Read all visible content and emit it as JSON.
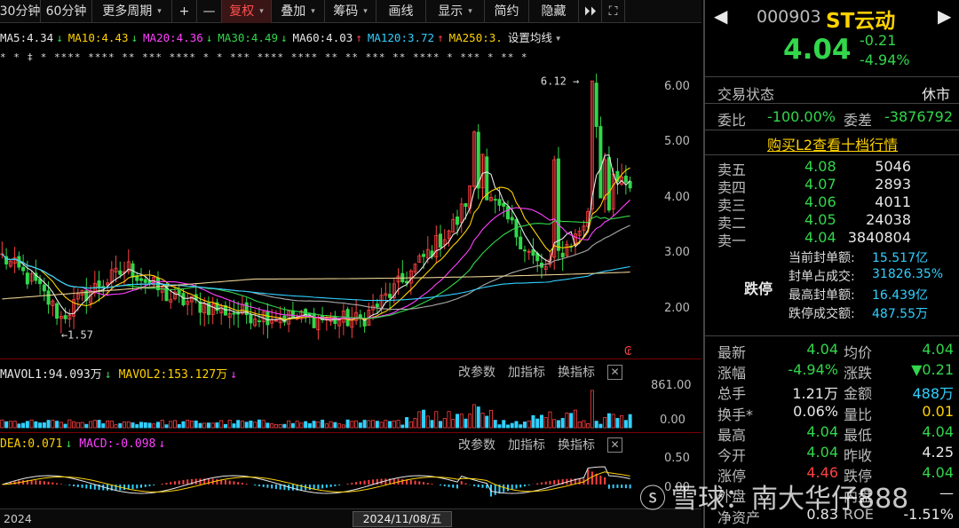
{
  "toolbar": {
    "items": [
      "30分钟",
      "60分钟",
      "更多周期",
      "+",
      "—",
      "复权",
      "叠加",
      "筹码",
      "画线",
      "显示",
      "简约",
      "隐藏",
      "⏵⏵",
      "⛶"
    ],
    "dropdown_caret": "▾",
    "active_item": "复权"
  },
  "ma_legend": [
    {
      "label": "MA5:4.34",
      "arrow": "↓",
      "color": "#e8e8e8",
      "arrow_color": "#32d74b"
    },
    {
      "label": "MA10:4.43",
      "arrow": "↓",
      "color": "#ffd200",
      "arrow_color": "#32d74b"
    },
    {
      "label": "MA20:4.36",
      "arrow": "↓",
      "color": "#ff40ff",
      "arrow_color": "#32d74b"
    },
    {
      "label": "MA30:4.49",
      "arrow": "↓",
      "color": "#32d74b",
      "arrow_color": "#32d74b"
    },
    {
      "label": "MA60:4.03",
      "arrow": "↑",
      "color": "#e8e8e8",
      "arrow_color": "#ff4040"
    },
    {
      "label": "MA120:3.72",
      "arrow": "↑",
      "color": "#30d0ff",
      "arrow_color": "#ff4040"
    },
    {
      "label": "MA250:3.",
      "arrow": "",
      "color": "#ffd200",
      "arrow_color": "#ffd200"
    },
    {
      "label": "设置均线",
      "arrow": "▾",
      "color": "#e8e8e8",
      "arrow_color": "#aaa"
    }
  ],
  "event_marks": "* * ‡      *    ****  ****  ** ***  ****  * *  ***  ****  ****  ** **  ***   ** ****  *  ***  * **  *",
  "price_axis": {
    "labels": [
      "6.00",
      "5.00",
      "4.00",
      "3.00",
      "2.00"
    ],
    "values": [
      6,
      5,
      4,
      3,
      2
    ],
    "max_marker": "6.12",
    "min_marker": "1.57",
    "icon": "₢"
  },
  "volume_panel": {
    "legend": [
      {
        "label": "MAVOL1:94.093万",
        "arrow": "↓",
        "color": "#e8e8e8",
        "arrow_color": "#32d74b"
      },
      {
        "label": "MAVOL2:153.127万",
        "arrow": "↓",
        "color": "#ffd200",
        "arrow_color": "#ff40ff"
      }
    ],
    "buttons": [
      "改参数",
      "加指标",
      "换指标"
    ],
    "close": "✕",
    "axis_labels": [
      "861.00",
      "0.00"
    ]
  },
  "macd_panel": {
    "legend": [
      {
        "label": "DEA:0.071",
        "arrow": "↓",
        "color": "#ffd200",
        "arrow_color": "#32d74b"
      },
      {
        "label": "MACD:-0.098",
        "arrow": "↓",
        "color": "#ff40ff",
        "arrow_color": "#ff40ff"
      }
    ],
    "buttons": [
      "改参数",
      "加指标",
      "换指标"
    ],
    "close": "✕",
    "axis_labels": [
      "0.50",
      "0.00"
    ]
  },
  "date_bar": {
    "left_label": "2024",
    "cursor_label": "2024/11/08/五"
  },
  "quote": {
    "code": "000903",
    "name": "ST云动",
    "price": "4.04",
    "change": "-0.21",
    "change_pct": "-4.94%",
    "nav_left": "◀",
    "nav_right": "▶",
    "trade_status_label": "交易状态",
    "trade_status": "休市",
    "weibi_label": "委比",
    "weibi": "-100.00%",
    "weicha_label": "委差",
    "weicha": "-3876792",
    "l2_link": "购买L2查看十档行情",
    "asks": [
      {
        "label": "卖五",
        "price": "4.08",
        "vol": "5046"
      },
      {
        "label": "卖四",
        "price": "4.07",
        "vol": "2893"
      },
      {
        "label": "卖三",
        "price": "4.06",
        "vol": "4011"
      },
      {
        "label": "卖二",
        "price": "4.05",
        "vol": "24038"
      },
      {
        "label": "卖一",
        "price": "4.04",
        "vol": "3840804"
      }
    ],
    "limit_down": {
      "tag": "跌停",
      "rows": [
        {
          "label": "当前封单额:",
          "value": "15.517亿"
        },
        {
          "label": "封单占成交:",
          "value": "31826.35%"
        },
        {
          "label": "最高封单额:",
          "value": "16.439亿"
        },
        {
          "label": "跌停成交额:",
          "value": "487.55万"
        }
      ]
    },
    "stats": [
      {
        "l1": "最新",
        "v1": "4.04",
        "c1": "green",
        "l2": "均价",
        "v2": "4.04",
        "c2": "green"
      },
      {
        "l1": "涨幅",
        "v1": "-4.94%",
        "c1": "green",
        "l2": "涨跌",
        "v2": "▼0.21",
        "c2": "green"
      },
      {
        "l1": "总手",
        "v1": "1.21万",
        "c1": "white",
        "l2": "金额",
        "v2": "488万",
        "c2": "cyan"
      },
      {
        "l1": "换手*",
        "v1": "0.06%",
        "c1": "white",
        "l2": "量比",
        "v2": "0.01",
        "c2": "yellow"
      },
      {
        "l1": "最高",
        "v1": "4.04",
        "c1": "green",
        "l2": "最低",
        "v2": "4.04",
        "c2": "green"
      },
      {
        "l1": "今开",
        "v1": "4.04",
        "c1": "green",
        "l2": "昨收",
        "v2": "4.25",
        "c2": "white"
      },
      {
        "l1": "涨停",
        "v1": "4.46",
        "c1": "red",
        "l2": "跌停",
        "v2": "4.04",
        "c2": "green"
      },
      {
        "l1": "外盘",
        "v1": "",
        "c1": "white",
        "l2": "内盘",
        "v2": "—",
        "c2": "white"
      },
      {
        "l1": "净资产",
        "v1": "0.83",
        "c1": "white",
        "l2": "ROE",
        "v2": "-1.51%",
        "c2": "white"
      }
    ]
  },
  "watermark": {
    "icon": "ⓢ",
    "text": "雪球：南大华仔888"
  },
  "colors": {
    "up": "#ff4040",
    "down": "#32d74b",
    "ma5": "#e8e8e8",
    "ma10": "#ffd200",
    "ma20": "#ff40ff",
    "ma30": "#32d74b",
    "ma60": "#aaaaaa",
    "ma120": "#30d0ff",
    "ma250": "#e8d090",
    "vol_down": "#30d0ff"
  }
}
